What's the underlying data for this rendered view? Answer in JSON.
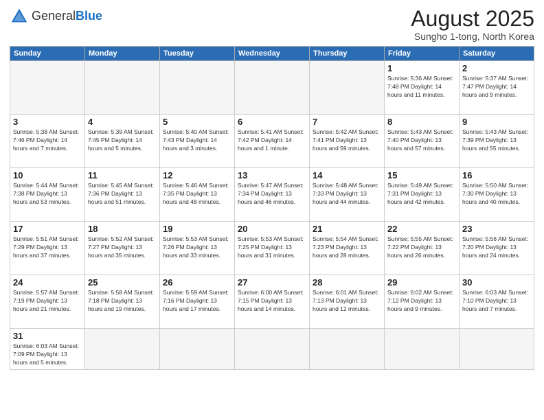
{
  "logo": {
    "general": "General",
    "blue": "Blue"
  },
  "title": "August 2025",
  "subtitle": "Sungho 1-tong, North Korea",
  "weekdays": [
    "Sunday",
    "Monday",
    "Tuesday",
    "Wednesday",
    "Thursday",
    "Friday",
    "Saturday"
  ],
  "weeks": [
    [
      {
        "day": "",
        "info": ""
      },
      {
        "day": "",
        "info": ""
      },
      {
        "day": "",
        "info": ""
      },
      {
        "day": "",
        "info": ""
      },
      {
        "day": "",
        "info": ""
      },
      {
        "day": "1",
        "info": "Sunrise: 5:36 AM\nSunset: 7:48 PM\nDaylight: 14 hours and 11 minutes."
      },
      {
        "day": "2",
        "info": "Sunrise: 5:37 AM\nSunset: 7:47 PM\nDaylight: 14 hours and 9 minutes."
      }
    ],
    [
      {
        "day": "3",
        "info": "Sunrise: 5:38 AM\nSunset: 7:46 PM\nDaylight: 14 hours and 7 minutes."
      },
      {
        "day": "4",
        "info": "Sunrise: 5:39 AM\nSunset: 7:45 PM\nDaylight: 14 hours and 5 minutes."
      },
      {
        "day": "5",
        "info": "Sunrise: 5:40 AM\nSunset: 7:43 PM\nDaylight: 14 hours and 3 minutes."
      },
      {
        "day": "6",
        "info": "Sunrise: 5:41 AM\nSunset: 7:42 PM\nDaylight: 14 hours and 1 minute."
      },
      {
        "day": "7",
        "info": "Sunrise: 5:42 AM\nSunset: 7:41 PM\nDaylight: 13 hours and 59 minutes."
      },
      {
        "day": "8",
        "info": "Sunrise: 5:43 AM\nSunset: 7:40 PM\nDaylight: 13 hours and 57 minutes."
      },
      {
        "day": "9",
        "info": "Sunrise: 5:43 AM\nSunset: 7:39 PM\nDaylight: 13 hours and 55 minutes."
      }
    ],
    [
      {
        "day": "10",
        "info": "Sunrise: 5:44 AM\nSunset: 7:38 PM\nDaylight: 13 hours and 53 minutes."
      },
      {
        "day": "11",
        "info": "Sunrise: 5:45 AM\nSunset: 7:36 PM\nDaylight: 13 hours and 51 minutes."
      },
      {
        "day": "12",
        "info": "Sunrise: 5:46 AM\nSunset: 7:35 PM\nDaylight: 13 hours and 48 minutes."
      },
      {
        "day": "13",
        "info": "Sunrise: 5:47 AM\nSunset: 7:34 PM\nDaylight: 13 hours and 46 minutes."
      },
      {
        "day": "14",
        "info": "Sunrise: 5:48 AM\nSunset: 7:33 PM\nDaylight: 13 hours and 44 minutes."
      },
      {
        "day": "15",
        "info": "Sunrise: 5:49 AM\nSunset: 7:31 PM\nDaylight: 13 hours and 42 minutes."
      },
      {
        "day": "16",
        "info": "Sunrise: 5:50 AM\nSunset: 7:30 PM\nDaylight: 13 hours and 40 minutes."
      }
    ],
    [
      {
        "day": "17",
        "info": "Sunrise: 5:51 AM\nSunset: 7:29 PM\nDaylight: 13 hours and 37 minutes."
      },
      {
        "day": "18",
        "info": "Sunrise: 5:52 AM\nSunset: 7:27 PM\nDaylight: 13 hours and 35 minutes."
      },
      {
        "day": "19",
        "info": "Sunrise: 5:53 AM\nSunset: 7:26 PM\nDaylight: 13 hours and 33 minutes."
      },
      {
        "day": "20",
        "info": "Sunrise: 5:53 AM\nSunset: 7:25 PM\nDaylight: 13 hours and 31 minutes."
      },
      {
        "day": "21",
        "info": "Sunrise: 5:54 AM\nSunset: 7:23 PM\nDaylight: 13 hours and 28 minutes."
      },
      {
        "day": "22",
        "info": "Sunrise: 5:55 AM\nSunset: 7:22 PM\nDaylight: 13 hours and 26 minutes."
      },
      {
        "day": "23",
        "info": "Sunrise: 5:56 AM\nSunset: 7:20 PM\nDaylight: 13 hours and 24 minutes."
      }
    ],
    [
      {
        "day": "24",
        "info": "Sunrise: 5:57 AM\nSunset: 7:19 PM\nDaylight: 13 hours and 21 minutes."
      },
      {
        "day": "25",
        "info": "Sunrise: 5:58 AM\nSunset: 7:18 PM\nDaylight: 13 hours and 19 minutes."
      },
      {
        "day": "26",
        "info": "Sunrise: 5:59 AM\nSunset: 7:16 PM\nDaylight: 13 hours and 17 minutes."
      },
      {
        "day": "27",
        "info": "Sunrise: 6:00 AM\nSunset: 7:15 PM\nDaylight: 13 hours and 14 minutes."
      },
      {
        "day": "28",
        "info": "Sunrise: 6:01 AM\nSunset: 7:13 PM\nDaylight: 13 hours and 12 minutes."
      },
      {
        "day": "29",
        "info": "Sunrise: 6:02 AM\nSunset: 7:12 PM\nDaylight: 13 hours and 9 minutes."
      },
      {
        "day": "30",
        "info": "Sunrise: 6:03 AM\nSunset: 7:10 PM\nDaylight: 13 hours and 7 minutes."
      }
    ],
    [
      {
        "day": "31",
        "info": "Sunrise: 6:03 AM\nSunset: 7:09 PM\nDaylight: 13 hours and 5 minutes."
      },
      {
        "day": "",
        "info": ""
      },
      {
        "day": "",
        "info": ""
      },
      {
        "day": "",
        "info": ""
      },
      {
        "day": "",
        "info": ""
      },
      {
        "day": "",
        "info": ""
      },
      {
        "day": "",
        "info": ""
      }
    ]
  ]
}
